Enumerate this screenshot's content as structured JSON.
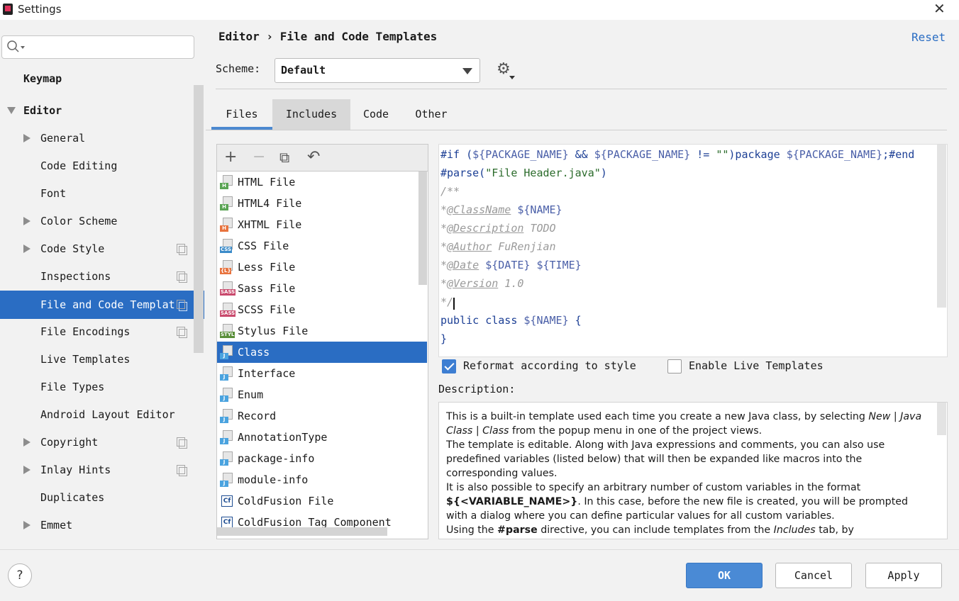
{
  "window": {
    "title": "Settings",
    "close_glyph": "✕"
  },
  "sidebar": {
    "search_placeholder": "",
    "items": [
      {
        "label": "Keymap",
        "level": 0,
        "bold": true
      },
      {
        "label": "Editor",
        "level": 0,
        "bold": true,
        "expanded": true
      },
      {
        "label": "General",
        "level": 1,
        "collapsible": true
      },
      {
        "label": "Code Editing",
        "level": 1
      },
      {
        "label": "Font",
        "level": 1
      },
      {
        "label": "Color Scheme",
        "level": 1,
        "collapsible": true
      },
      {
        "label": "Code Style",
        "level": 1,
        "collapsible": true,
        "project_icon": true
      },
      {
        "label": "Inspections",
        "level": 1,
        "project_icon": true
      },
      {
        "label": "File and Code Templat",
        "level": 1,
        "selected": true,
        "project_icon": true
      },
      {
        "label": "File Encodings",
        "level": 1,
        "project_icon": true
      },
      {
        "label": "Live Templates",
        "level": 1
      },
      {
        "label": "File Types",
        "level": 1
      },
      {
        "label": "Android Layout Editor",
        "level": 1
      },
      {
        "label": "Copyright",
        "level": 1,
        "collapsible": true,
        "project_icon": true
      },
      {
        "label": "Inlay Hints",
        "level": 1,
        "collapsible": true,
        "project_icon": true
      },
      {
        "label": "Duplicates",
        "level": 1
      },
      {
        "label": "Emmet",
        "level": 1,
        "collapsible": true
      }
    ]
  },
  "header": {
    "breadcrumb": "Editor › File and Code Templates",
    "reset": "Reset",
    "scheme_label": "Scheme:",
    "scheme_value": "Default",
    "gear_icon": "gear-icon"
  },
  "tabs": [
    {
      "label": "Files",
      "active": true
    },
    {
      "label": "Includes"
    },
    {
      "label": "Code"
    },
    {
      "label": "Other"
    }
  ],
  "toolbar": {
    "add": "+",
    "remove": "−",
    "copy": "⧉",
    "reset": "↶"
  },
  "files": [
    {
      "name": "HTML File",
      "tag": "H",
      "color": "#5aa454"
    },
    {
      "name": "HTML4 File",
      "tag": "H",
      "color": "#5aa454"
    },
    {
      "name": "XHTML File",
      "tag": "H",
      "color": "#e8733e"
    },
    {
      "name": "CSS File",
      "tag": "CSS",
      "color": "#3b8bc9"
    },
    {
      "name": "Less File",
      "tag": "{L}",
      "color": "#e8733e"
    },
    {
      "name": "Sass File",
      "tag": "SASS",
      "color": "#c94a6d"
    },
    {
      "name": "SCSS File",
      "tag": "SASS",
      "color": "#c94a6d"
    },
    {
      "name": "Stylus File",
      "tag": "STYL",
      "color": "#5a8f3a"
    },
    {
      "name": "Class",
      "tag": "J",
      "color": "#4aa3df",
      "selected": true
    },
    {
      "name": "Interface",
      "tag": "J",
      "color": "#4aa3df"
    },
    {
      "name": "Enum",
      "tag": "J",
      "color": "#4aa3df"
    },
    {
      "name": "Record",
      "tag": "J",
      "color": "#4aa3df"
    },
    {
      "name": "AnnotationType",
      "tag": "J",
      "color": "#4aa3df"
    },
    {
      "name": "package-info",
      "tag": "J",
      "color": "#4aa3df"
    },
    {
      "name": "module-info",
      "tag": "J",
      "color": "#4aa3df"
    },
    {
      "name": "ColdFusion File",
      "tag": "Cf",
      "color": "#1d4c91"
    },
    {
      "name": "ColdFusion Tag Component",
      "tag": "Cf",
      "color": "#1d4c91"
    }
  ],
  "editor": {
    "lines": [
      {
        "segments": [
          {
            "t": "#if (",
            "c": "kw"
          },
          {
            "t": "${PACKAGE_NAME}",
            "c": "var"
          },
          {
            "t": " && ",
            "c": "kw"
          },
          {
            "t": "${PACKAGE_NAME}",
            "c": "var"
          },
          {
            "t": " != ",
            "c": "kw"
          },
          {
            "t": "\"\"",
            "c": "str"
          },
          {
            "t": ")package ",
            "c": "kw"
          },
          {
            "t": "${PACKAGE_NAME}",
            "c": "var"
          },
          {
            "t": ";#end",
            "c": "kw"
          }
        ]
      },
      {
        "segments": [
          {
            "t": "#parse(",
            "c": "kw"
          },
          {
            "t": "\"File Header.java\"",
            "c": "str"
          },
          {
            "t": ")",
            "c": "kw"
          }
        ]
      },
      {
        "segments": [
          {
            "t": "/**",
            "c": "cmt"
          }
        ]
      },
      {
        "segments": [
          {
            "t": "*",
            "c": "cmt"
          },
          {
            "t": "@ClassName",
            "c": "tagu"
          },
          {
            "t": " ",
            "c": "cmt"
          },
          {
            "t": "${NAME}",
            "c": "var"
          }
        ]
      },
      {
        "segments": [
          {
            "t": "*",
            "c": "cmt"
          },
          {
            "t": "@Description",
            "c": "tagu"
          },
          {
            "t": " TODO",
            "c": "cmt"
          }
        ]
      },
      {
        "segments": [
          {
            "t": "*",
            "c": "cmt"
          },
          {
            "t": "@Author",
            "c": "tagu"
          },
          {
            "t": " FuRenjian",
            "c": "cmt"
          }
        ]
      },
      {
        "segments": [
          {
            "t": "*",
            "c": "cmt"
          },
          {
            "t": "@Date",
            "c": "tagu"
          },
          {
            "t": " ",
            "c": "cmt"
          },
          {
            "t": "${DATE}",
            "c": "var"
          },
          {
            "t": " ",
            "c": "cmt"
          },
          {
            "t": "${TIME}",
            "c": "var"
          }
        ]
      },
      {
        "segments": [
          {
            "t": "*",
            "c": "cmt"
          },
          {
            "t": "@Version",
            "c": "tagu"
          },
          {
            "t": " 1.0",
            "c": "cmt"
          }
        ]
      },
      {
        "segments": [
          {
            "t": "*/",
            "c": "cmt"
          }
        ]
      },
      {
        "segments": [
          {
            "t": "public class ",
            "c": "kw"
          },
          {
            "t": "${NAME}",
            "c": "var"
          },
          {
            "t": " {",
            "c": "kw"
          }
        ]
      },
      {
        "segments": [
          {
            "t": "}",
            "c": "kw"
          }
        ]
      }
    ]
  },
  "options": {
    "reformat_label": "Reformat according to style",
    "reformat_checked": true,
    "live_templates_label": "Enable Live Templates",
    "live_templates_checked": false
  },
  "description": {
    "label": "Description:",
    "html": "This is a built-in template used each time you create a new Java class, by selecting <i>New | Java Class | Class</i> from the popup menu in one of the project views.<br>The template is editable. Along with Java expressions and comments, you can also use predefined variables (listed below) that will then be expanded like macros into the corresponding values.<br>It is also possible to specify an arbitrary number of custom variables in the format <b>${&lt;VARIABLE_NAME&gt;}</b>. In this case, before the new file is created, you will be prompted with a dialog where you can define particular values for all custom variables.<br>Using the <b>#parse</b> directive, you can include templates from the <i>Includes</i> tab, by"
  },
  "buttons": {
    "help": "?",
    "ok": "OK",
    "cancel": "Cancel",
    "apply": "Apply"
  }
}
